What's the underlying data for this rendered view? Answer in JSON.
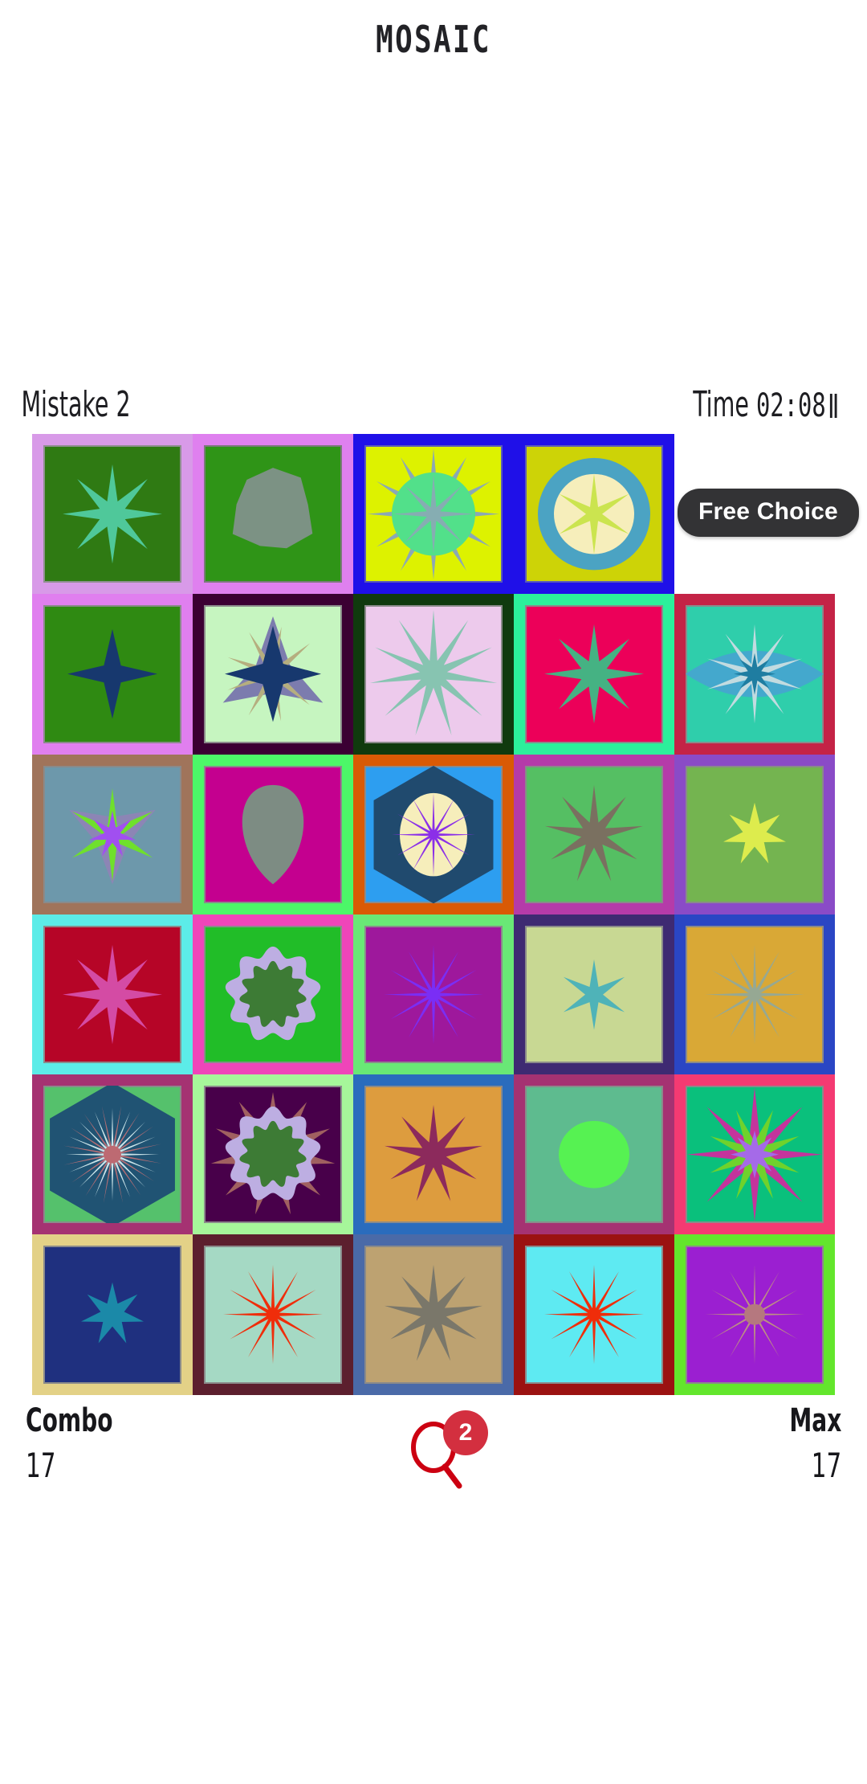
{
  "header": {
    "title": "MOSAIC"
  },
  "status": {
    "mistake_label": "Mistake",
    "mistake_value": "2",
    "time_label": "Time",
    "time_value": "02:08",
    "pause_icon": "pause-icon"
  },
  "tooltip": {
    "free_choice_label": "Free Choice"
  },
  "footer": {
    "combo_label": "Combo",
    "combo_value": "17",
    "max_label": "Max",
    "max_value": "17",
    "hint_icon": "magnifier-icon",
    "hint_count": "2",
    "hint_color": "#d32f3f"
  },
  "grid": {
    "columns": 5,
    "rows": 6,
    "cells": [
      {
        "r": 1,
        "c": 1,
        "frame": "#d89ae8",
        "bg": "#2f7a13",
        "shape": "star8",
        "shape_color": "#4fc89a",
        "inner_frame": "#8f8f8f"
      },
      {
        "r": 1,
        "c": 2,
        "frame": "#df80ef",
        "bg": "#2f9417",
        "shape": "blob",
        "shape_color": "#7c9284",
        "inner_frame": "#7a7a7a"
      },
      {
        "r": 1,
        "c": 3,
        "frame": "#1f10e8",
        "bg": "#ddf200",
        "shape": "circle-star12",
        "shape_color": "#8ba8b5",
        "circle_color": "#52e08a",
        "inner_frame": "#5b5bb8"
      },
      {
        "r": 1,
        "c": 4,
        "frame": "#1f10e8",
        "bg": "#cdd307",
        "shape": "ring-star6",
        "shape_color": "#cbe44f",
        "ring_color": "#4ba3c3",
        "disc_color": "#f6eebb",
        "inner_frame": "#5b5bb8"
      },
      {
        "r": 1,
        "c": 5,
        "frame": "none",
        "bg": "none",
        "shape": "none",
        "shape_color": "none"
      },
      {
        "r": 2,
        "c": 1,
        "frame": "#e07fef",
        "bg": "#2f8a12",
        "shape": "star4",
        "shape_color": "#17386e",
        "inner_frame": "#8a8a8a"
      },
      {
        "r": 2,
        "c": 2,
        "frame": "#3b0033",
        "bg": "#c6f5c0",
        "shape": "layered-star",
        "shape_color": "#17386e",
        "accent1": "#7c7cae",
        "accent2": "#b5ae7f",
        "inner_frame": "#8a8a8a"
      },
      {
        "r": 2,
        "c": 3,
        "frame": "#103a0e",
        "bg": "#edcaec",
        "shape": "star11",
        "shape_color": "#87c4b1",
        "inner_frame": "#8a8a8a"
      },
      {
        "r": 2,
        "c": 4,
        "frame": "#2cf09b",
        "bg": "#ec0059",
        "shape": "star8",
        "shape_color": "#45b283",
        "inner_frame": "#8a8a8a"
      },
      {
        "r": 2,
        "c": 5,
        "frame": "#c42346",
        "bg": "#2fceab",
        "shape": "lens-star10",
        "shape_color": "#c2dbe0",
        "lens_color": "#44a8cd",
        "core_color": "#1f7da1",
        "inner_frame": "#8a8a8a"
      },
      {
        "r": 3,
        "c": 1,
        "frame": "#a0745b",
        "bg": "#6d98ab",
        "shape": "tri-star",
        "shape_color": "#a14ff0",
        "accent1": "#6fe02c",
        "accent2": "#8c85b5",
        "inner_frame": "#8a8a8a"
      },
      {
        "r": 3,
        "c": 2,
        "frame": "#4cf768",
        "bg": "#c4008f",
        "shape": "egg",
        "shape_color": "#7d8c83",
        "inner_frame": "#8a8a8a"
      },
      {
        "r": 3,
        "c": 3,
        "frame": "#d95a05",
        "bg": "#2d9ef0",
        "shape": "hex-disc-star12",
        "shape_color": "#8b2fe8",
        "hex_color": "#204a6e",
        "disc_color": "#f6eebb",
        "inner_frame": "#8a8a8a"
      },
      {
        "r": 3,
        "c": 4,
        "frame": "#b53ba9",
        "bg": "#55bf63",
        "shape": "star9",
        "shape_color": "#7a7060",
        "inner_frame": "#8a8a8a"
      },
      {
        "r": 3,
        "c": 5,
        "frame": "#8a4bc7",
        "bg": "#74b450",
        "shape": "star7",
        "shape_color": "#ddec4d",
        "inner_frame": "#8a8a8a"
      },
      {
        "r": 4,
        "c": 1,
        "frame": "#5cece8",
        "bg": "#b60527",
        "shape": "star8",
        "shape_color": "#d44ba4",
        "inner_frame": "#8a8a8a"
      },
      {
        "r": 4,
        "c": 2,
        "frame": "#ef45b9",
        "bg": "#21bd28",
        "shape": "flower-double",
        "shape_color": "#3d7b35",
        "petal_color": "#bdaee2",
        "inner_frame": "#8a8a8a"
      },
      {
        "r": 4,
        "c": 3,
        "frame": "#69e876",
        "bg": "#9e189c",
        "shape": "star12",
        "shape_color": "#7a2ef5",
        "inner_frame": "#8a8a8a"
      },
      {
        "r": 4,
        "c": 4,
        "frame": "#3e2a72",
        "bg": "#c8d893",
        "shape": "star6",
        "shape_color": "#4fb3b8",
        "inner_frame": "#8a8a8a"
      },
      {
        "r": 4,
        "c": 5,
        "frame": "#2a46c4",
        "bg": "#d9a836",
        "shape": "star12",
        "shape_color": "#96a893",
        "inner_frame": "#8a8a8a"
      },
      {
        "r": 5,
        "c": 1,
        "frame": "#a53272",
        "bg": "#55c16c",
        "shape": "hex-burst",
        "shape_color": "#c9e3e8",
        "hex_color": "#205373",
        "accent2": "#b56e74",
        "core_color": "#bd6a72",
        "inner_frame": "#8a8a8a"
      },
      {
        "r": 5,
        "c": 2,
        "frame": "#a6f69a",
        "bg": "#48004a",
        "shape": "flower-double",
        "shape_color": "#3d7b35",
        "petal_color": "#bdaee2",
        "accent2": "#a06060",
        "inner_frame": "#8a8a8a"
      },
      {
        "r": 5,
        "c": 3,
        "frame": "#2a6cbd",
        "bg": "#dd9c3e",
        "shape": "star9",
        "shape_color": "#8c2a5c",
        "inner_frame": "#8a8a8a"
      },
      {
        "r": 5,
        "c": 4,
        "frame": "#a53272",
        "bg": "#5ebb8f",
        "shape": "disc",
        "shape_color": "#56f252",
        "inner_frame": "#8a8a8a"
      },
      {
        "r": 5,
        "c": 5,
        "frame": "#f43a72",
        "bg": "#0ac07c",
        "shape": "multi-star",
        "shape_color": "#c4349c",
        "accent1": "#6fd22c",
        "core_color": "#a56ae8",
        "inner_frame": "#8a8a8a"
      },
      {
        "r": 6,
        "c": 1,
        "frame": "#e3d187",
        "bg": "#1f307f",
        "shape": "star7",
        "shape_color": "#1b89a8",
        "inner_frame": "#8a8a8a"
      },
      {
        "r": 6,
        "c": 2,
        "frame": "#5c1f2e",
        "bg": "#a5d9c4",
        "shape": "star12",
        "shape_color": "#ef2d0a",
        "inner_frame": "#8a8a8a"
      },
      {
        "r": 6,
        "c": 3,
        "frame": "#4a6aa8",
        "bg": "#bda271",
        "shape": "star9",
        "shape_color": "#7a776a",
        "inner_frame": "#8a8a8a"
      },
      {
        "r": 6,
        "c": 4,
        "frame": "#9b1211",
        "bg": "#5eeaf2",
        "shape": "star12",
        "shape_color": "#ef2d0a",
        "core_color": "#ef2d0a",
        "inner_frame": "#8a8a8a"
      },
      {
        "r": 6,
        "c": 5,
        "frame": "#63e62c",
        "bg": "#9b1fd1",
        "shape": "star12-thin",
        "shape_color": "#bd9182",
        "core_color": "#b5787f",
        "inner_frame": "#8a8a8a"
      }
    ]
  }
}
